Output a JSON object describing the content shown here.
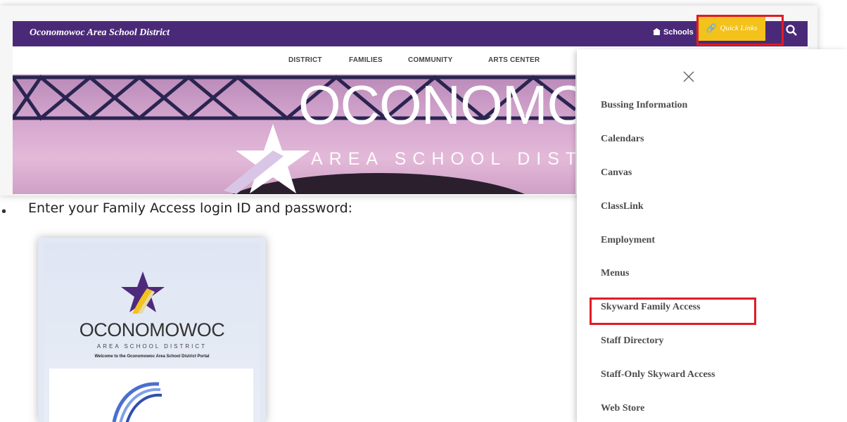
{
  "site": {
    "title": "Oconomowoc Area School District",
    "schools_label": "Schools",
    "quick_links_label": "Quick Links",
    "nav": [
      "DISTRICT",
      "FAMILIES",
      "COMMUNITY",
      "ARTS CENTER"
    ],
    "hero_title": "OCONOMOWOC",
    "hero_subtitle": "AREA SCHOOL DISTRICT"
  },
  "quick_links_panel": {
    "items": [
      "Bussing Information",
      "Calendars",
      "Canvas",
      "ClassLink",
      "Employment",
      "Menus",
      "Skyward Family Access",
      "Staff Directory",
      "Staff-Only Skyward Access",
      "Web Store"
    ],
    "highlighted_item": "Skyward Family Access"
  },
  "instruction": {
    "bullet": "•",
    "text": "Enter your Family Access login ID and password:"
  },
  "portal": {
    "name": "OCONOMOWOC",
    "subtitle": "AREA SCHOOL DISTRICT",
    "welcome": "Welcome to the Oconomowoc Area School District Portal"
  },
  "colors": {
    "brand_purple": "#4a2a78",
    "quick_links_yellow": "#f3c21b",
    "highlight_red": "#e01b24"
  },
  "icons": [
    "school-building-icon",
    "link-icon",
    "search-icon",
    "close-icon",
    "star-logo-icon",
    "classlink-logo-icon"
  ]
}
